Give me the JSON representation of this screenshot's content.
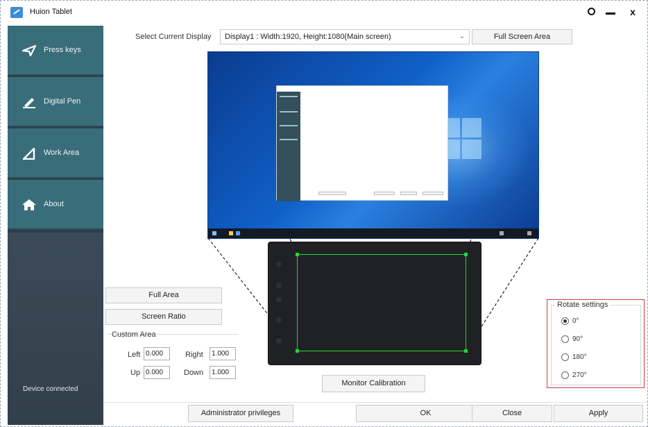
{
  "window": {
    "title": "Huion Tablet",
    "controls": [
      "settings-icon",
      "minimize-icon",
      "close-icon"
    ],
    "close_glyph": "x"
  },
  "sidebar": {
    "items": [
      {
        "label": "Press keys",
        "icon": "send-arrow-icon"
      },
      {
        "label": "Digital Pen",
        "icon": "pen-icon"
      },
      {
        "label": "Work Area",
        "icon": "triangle-area-icon"
      },
      {
        "label": "About",
        "icon": "home-icon"
      }
    ],
    "status": "Device connected"
  },
  "display": {
    "label": "Select Current Display",
    "selected": "Display1 : Width:1920, Height:1080(Main screen)",
    "full_screen_label": "Full Screen Area"
  },
  "work_area": {
    "full_area_label": "Full Area",
    "screen_ratio_label": "Screen Ratio",
    "custom_area_title": "Custom Area",
    "fields": {
      "left_label": "Left",
      "left_value": "0.000",
      "right_label": "Right",
      "right_value": "1.000",
      "up_label": "Up",
      "up_value": "0.000",
      "down_label": "Down",
      "down_value": "1.000"
    },
    "calibration_label": "Monitor Calibration"
  },
  "rotate": {
    "title": "Rotate settings",
    "options": [
      "0°",
      "90°",
      "180°",
      "270°"
    ],
    "selected": "0°"
  },
  "actions": {
    "admin_label": "Administrator privileges",
    "ok_label": "OK",
    "close_label": "Close",
    "apply_label": "Apply"
  },
  "colors": {
    "sidebar_item": "#3a6d7a",
    "sidebar_bg": "#2e3e4c",
    "area_border": "#27d637",
    "rotate_highlight": "#d23a3a"
  }
}
